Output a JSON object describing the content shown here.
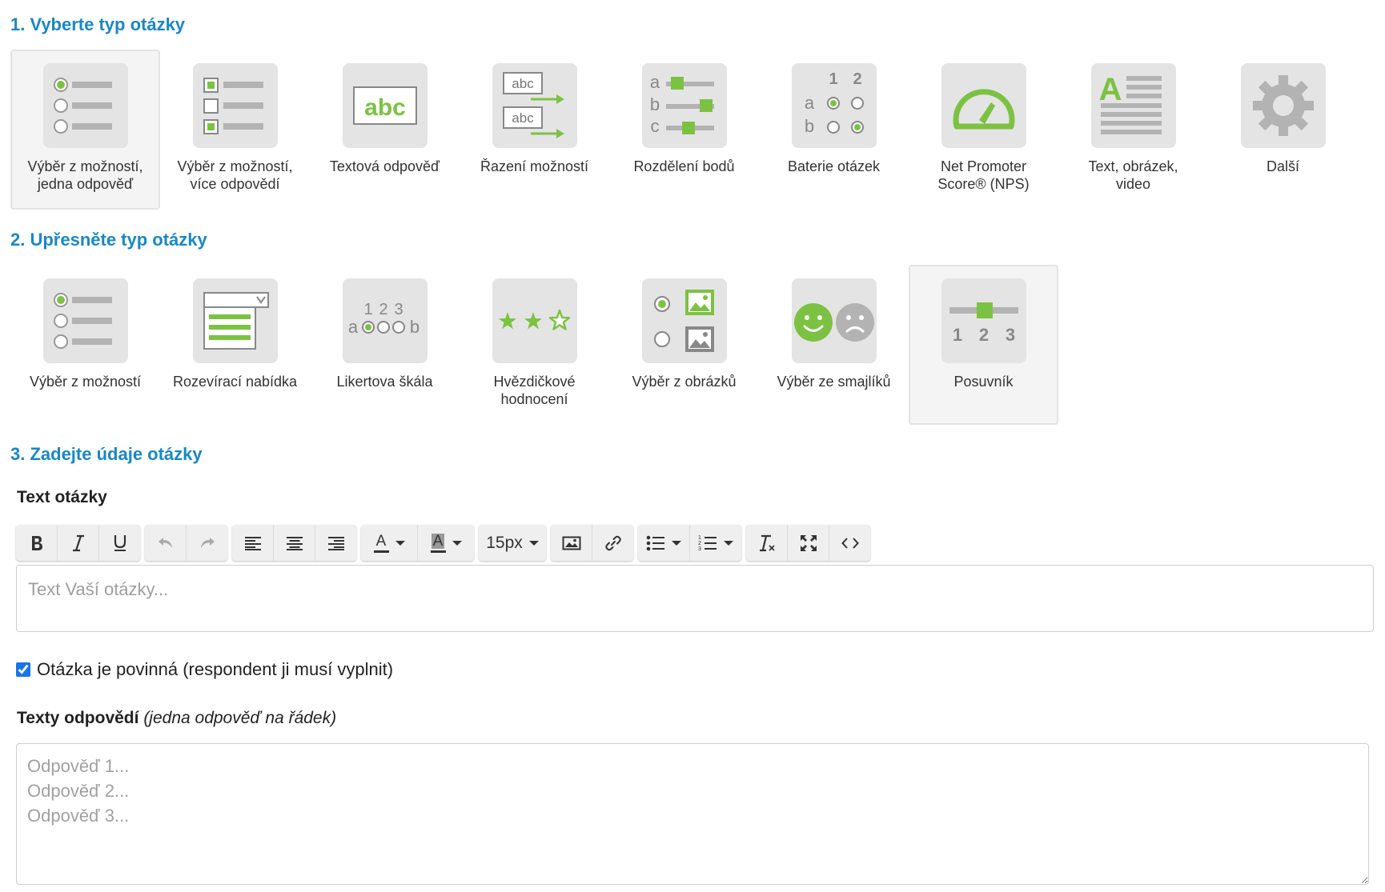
{
  "step1": {
    "heading": "1. Vyberte typ otázky",
    "tiles": [
      {
        "label": "Výběr z možností,\njedna odpověď",
        "icon": "single-choice-icon",
        "selected": true
      },
      {
        "label": "Výběr z možností,\nvíce odpovědí",
        "icon": "multiple-choice-icon",
        "selected": false
      },
      {
        "label": "Textová odpověď",
        "icon": "text-answer-icon",
        "selected": false
      },
      {
        "label": "Řazení možností",
        "icon": "ranking-icon",
        "selected": false
      },
      {
        "label": "Rozdělení bodů",
        "icon": "point-distribution-icon",
        "selected": false
      },
      {
        "label": "Baterie otázek",
        "icon": "question-battery-icon",
        "selected": false
      },
      {
        "label": "Net Promoter\nScore® (NPS)",
        "icon": "nps-gauge-icon",
        "selected": false
      },
      {
        "label": "Text, obrázek,\nvideo",
        "icon": "text-image-video-icon",
        "selected": false
      },
      {
        "label": "Další",
        "icon": "gear-icon",
        "selected": false
      }
    ]
  },
  "step2": {
    "heading": "2. Upřesněte typ otázky",
    "tiles": [
      {
        "label": "Výběr z možností",
        "icon": "radio-list-icon",
        "selected": false
      },
      {
        "label": "Rozevírací nabídka",
        "icon": "dropdown-menu-icon",
        "selected": false
      },
      {
        "label": "Likertova škála",
        "icon": "likert-scale-icon",
        "selected": false
      },
      {
        "label": "Hvězdičkové\nhodnocení",
        "icon": "star-rating-icon",
        "selected": false
      },
      {
        "label": "Výběr z obrázků",
        "icon": "image-choice-icon",
        "selected": false
      },
      {
        "label": "Výběr ze smajlíků",
        "icon": "smiley-choice-icon",
        "selected": false
      },
      {
        "label": "Posuvník",
        "icon": "slider-icon",
        "selected": true
      }
    ]
  },
  "step3": {
    "heading": "3. Zadejte údaje otázky",
    "question_label": "Text otázky",
    "question_placeholder": "Text Vaší otázky...",
    "font_size": "15px",
    "toolbar_letters": {
      "text_color": "A",
      "background_color": "A"
    },
    "required_label": "Otázka je povinná (respondent ji musí vyplnit)",
    "required_checked": true,
    "answers_label": "Texty odpovědí",
    "answers_hint": "(jedna odpověď na řádek)",
    "answers_placeholder": "Odpověď 1...\nOdpověď 2...\nOdpověď 3..."
  },
  "colors": {
    "heading": "#1a87c6",
    "accent_green": "#7cc242",
    "icon_gray": "#b3b3b3",
    "icon_bg": "#e4e4e4"
  }
}
